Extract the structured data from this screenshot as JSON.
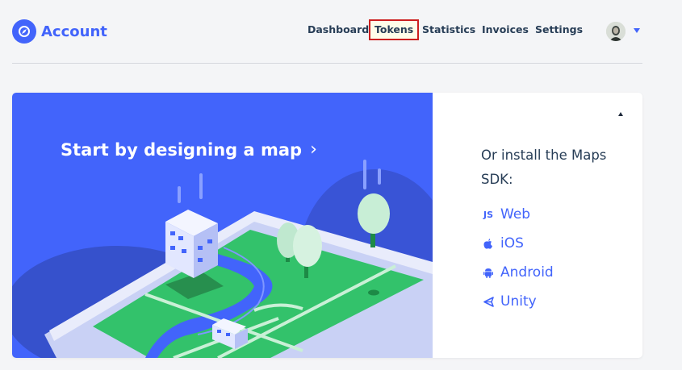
{
  "app": {
    "title": "Account",
    "brand_color": "#4264fb"
  },
  "nav": {
    "items": [
      {
        "label": "Dashboard"
      },
      {
        "label": "Tokens",
        "active": true
      },
      {
        "label": "Statistics"
      },
      {
        "label": "Invoices"
      },
      {
        "label": "Settings"
      }
    ]
  },
  "user": {
    "avatar_icon": "user-avatar",
    "menu_icon": "caret-down-icon"
  },
  "hero": {
    "title": "Start by designing a map",
    "arrow": "›",
    "background": "#4264fb"
  },
  "side": {
    "install_text": "Or install the Maps SDK:",
    "sdks": [
      {
        "label": "Web",
        "icon": "JS"
      },
      {
        "label": "iOS",
        "icon": "apple-icon"
      },
      {
        "label": "Android",
        "icon": "android-icon"
      },
      {
        "label": "Unity",
        "icon": "unity-icon"
      }
    ]
  }
}
